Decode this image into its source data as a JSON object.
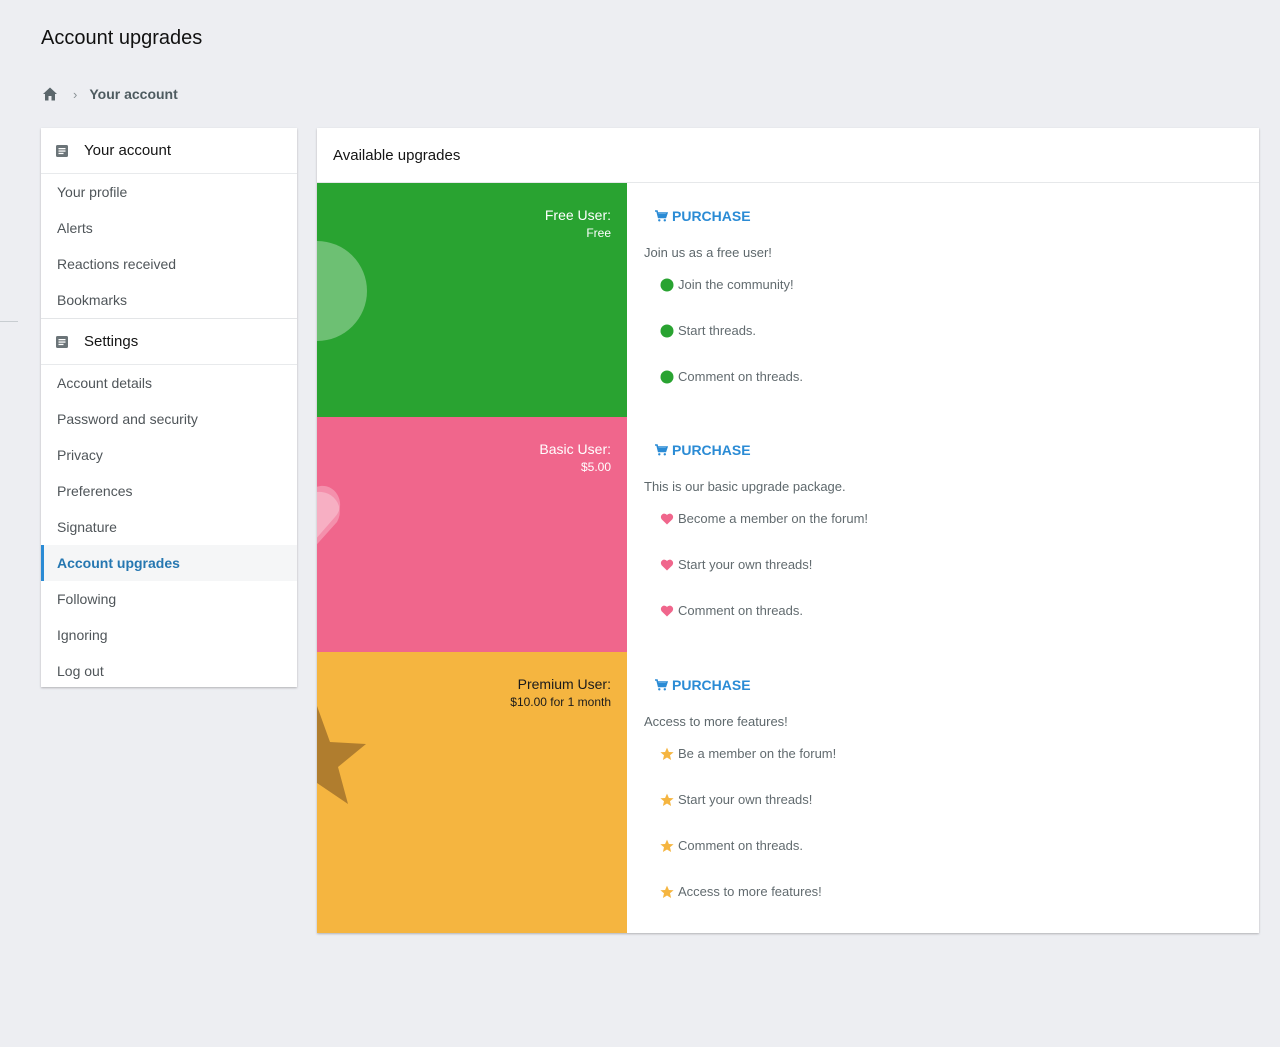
{
  "page": {
    "title": "Account upgrades"
  },
  "breadcrumb": {
    "home_icon": "home-icon",
    "items": [
      "Your account"
    ]
  },
  "sidebar": {
    "sections": [
      {
        "title": "Your account",
        "icon": "document-icon",
        "items": [
          {
            "label": "Your profile"
          },
          {
            "label": "Alerts"
          },
          {
            "label": "Reactions received"
          },
          {
            "label": "Bookmarks"
          }
        ]
      },
      {
        "title": "Settings",
        "icon": "document-icon",
        "items": [
          {
            "label": "Account details"
          },
          {
            "label": "Password and security"
          },
          {
            "label": "Privacy"
          },
          {
            "label": "Preferences"
          },
          {
            "label": "Signature"
          },
          {
            "label": "Account upgrades",
            "active": true
          },
          {
            "label": "Following"
          },
          {
            "label": "Ignoring"
          },
          {
            "label": "Log out"
          }
        ]
      }
    ]
  },
  "main": {
    "title": "Available upgrades",
    "upgrades": [
      {
        "name": "Free User:",
        "price": "Free",
        "color": "#29a331",
        "purchase_label": "PURCHASE",
        "description": "Join us as a free user!",
        "feature_icon": "green-dot-icon",
        "features": [
          "Join the community!",
          "Start threads.",
          "Comment on threads."
        ]
      },
      {
        "name": "Basic User:",
        "price": "$5.00",
        "color": "#f0668c",
        "purchase_label": "PURCHASE",
        "description": "This is our basic upgrade package.",
        "feature_icon": "heart-icon",
        "features": [
          "Become a member on the forum!",
          "Start your own threads!",
          "Comment on threads."
        ]
      },
      {
        "name": "Premium User:",
        "price": "$10.00 for 1 month",
        "color": "#f5b540",
        "purchase_label": "PURCHASE",
        "description": "Access to more features!",
        "feature_icon": "star-icon",
        "features": [
          "Be a member on the forum!",
          "Start your own threads!",
          "Comment on threads.",
          "Access to more features!"
        ]
      }
    ]
  },
  "colors": {
    "accent": "#2a8bd5",
    "background": "#edeef2"
  }
}
